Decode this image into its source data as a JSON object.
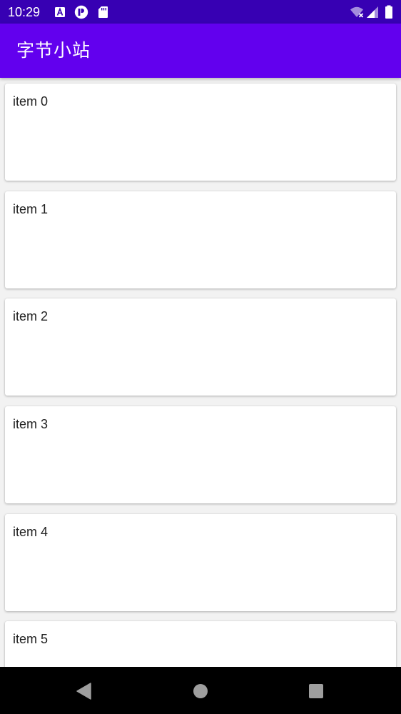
{
  "status_bar": {
    "time": "10:29",
    "left_icons": [
      "font-a-icon",
      "profile-p-icon",
      "sd-card-icon"
    ],
    "right_icons": [
      "wifi-no-connection-icon",
      "cell-signal-icon",
      "battery-icon"
    ]
  },
  "app_bar": {
    "title": "字节小站",
    "color": "#6200ee",
    "status_color": "#3700b3"
  },
  "list": {
    "items": [
      {
        "label": "item 0"
      },
      {
        "label": "item 1"
      },
      {
        "label": "item 2"
      },
      {
        "label": "item 3"
      },
      {
        "label": "item 4"
      },
      {
        "label": "item 5"
      }
    ]
  },
  "nav_bar": {
    "buttons": [
      "back-triangle-icon",
      "home-circle-icon",
      "recents-square-icon"
    ]
  }
}
